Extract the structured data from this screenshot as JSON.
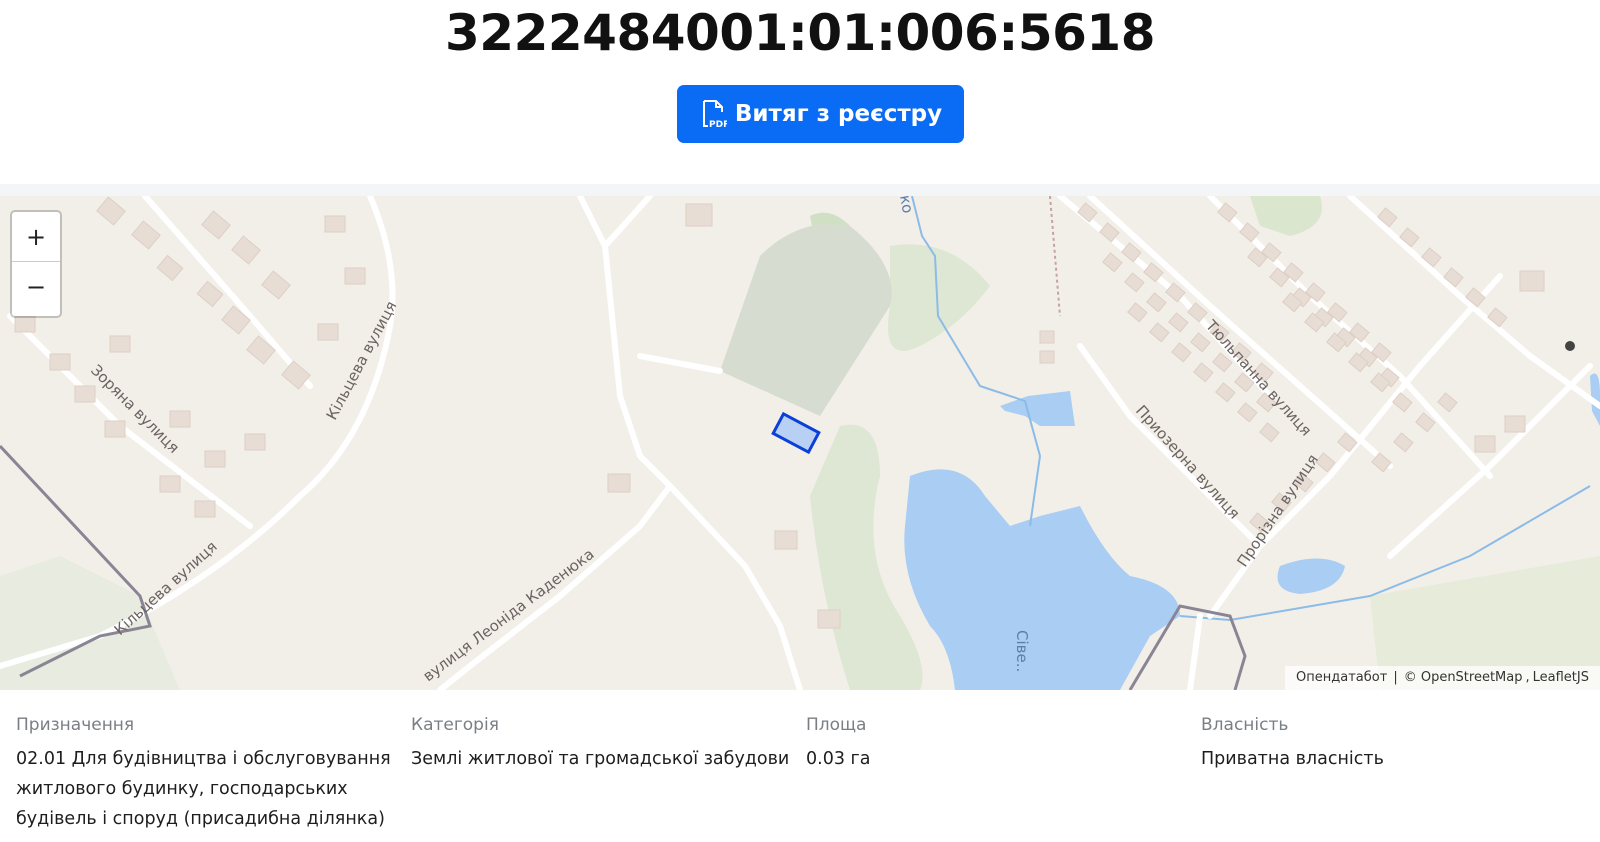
{
  "page": {
    "title": "3222484001:01:006:5618"
  },
  "actions": {
    "extract_label": "Витяг з реєстру",
    "extract_icon": "pdf-file-icon"
  },
  "map": {
    "zoom_in_label": "+",
    "zoom_out_label": "−",
    "attribution": {
      "opendatabot": "Опендатабот",
      "separator": "|",
      "osm": "© OpenStreetMap",
      "leaflet": "LeafletJS"
    },
    "streets": {
      "zoriana": "Зоряна вулиця",
      "kiltseva_top": "Кільцева вулиця",
      "kiltseva_bottom": "Кільцева вулиця",
      "kadeniuka": "вулиця Леоніда Каденюка",
      "tyulpanna": "Тюльпанна вулиця",
      "pryozerna": "Приозерна вулиця",
      "prorizna": "Прорізна вулиця",
      "lake": "Сіве..",
      "top_fragment": "ко"
    },
    "colors": {
      "land": "#f2efe9",
      "water": "#a9cdf3",
      "road": "#ffffff",
      "parcel": "#0a3fd8"
    }
  },
  "details": {
    "purpose_label": "Призначення",
    "purpose_line1": "02.01 Для будівництва і обслуговування",
    "purpose_line2": "житлового будинку, господарських",
    "purpose_line3": "будівель і споруд (присадибна ділянка)",
    "category_label": "Категорія",
    "category_value": "Землі житлової та громадської забудови",
    "area_label": "Площа",
    "area_value": "0.03 га",
    "ownership_label": "Власність",
    "ownership_value": "Приватна власність"
  }
}
